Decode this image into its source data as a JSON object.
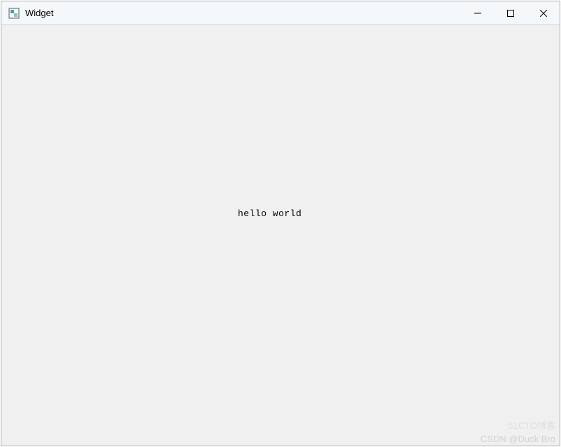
{
  "window": {
    "title": "Widget",
    "icon": "app-icon"
  },
  "controls": {
    "minimize": "minimize",
    "maximize": "maximize",
    "close": "close"
  },
  "content": {
    "label": "hello world"
  },
  "watermarks": {
    "line1": "51CTO博客",
    "line2": "CSDN @Duck Bro"
  }
}
